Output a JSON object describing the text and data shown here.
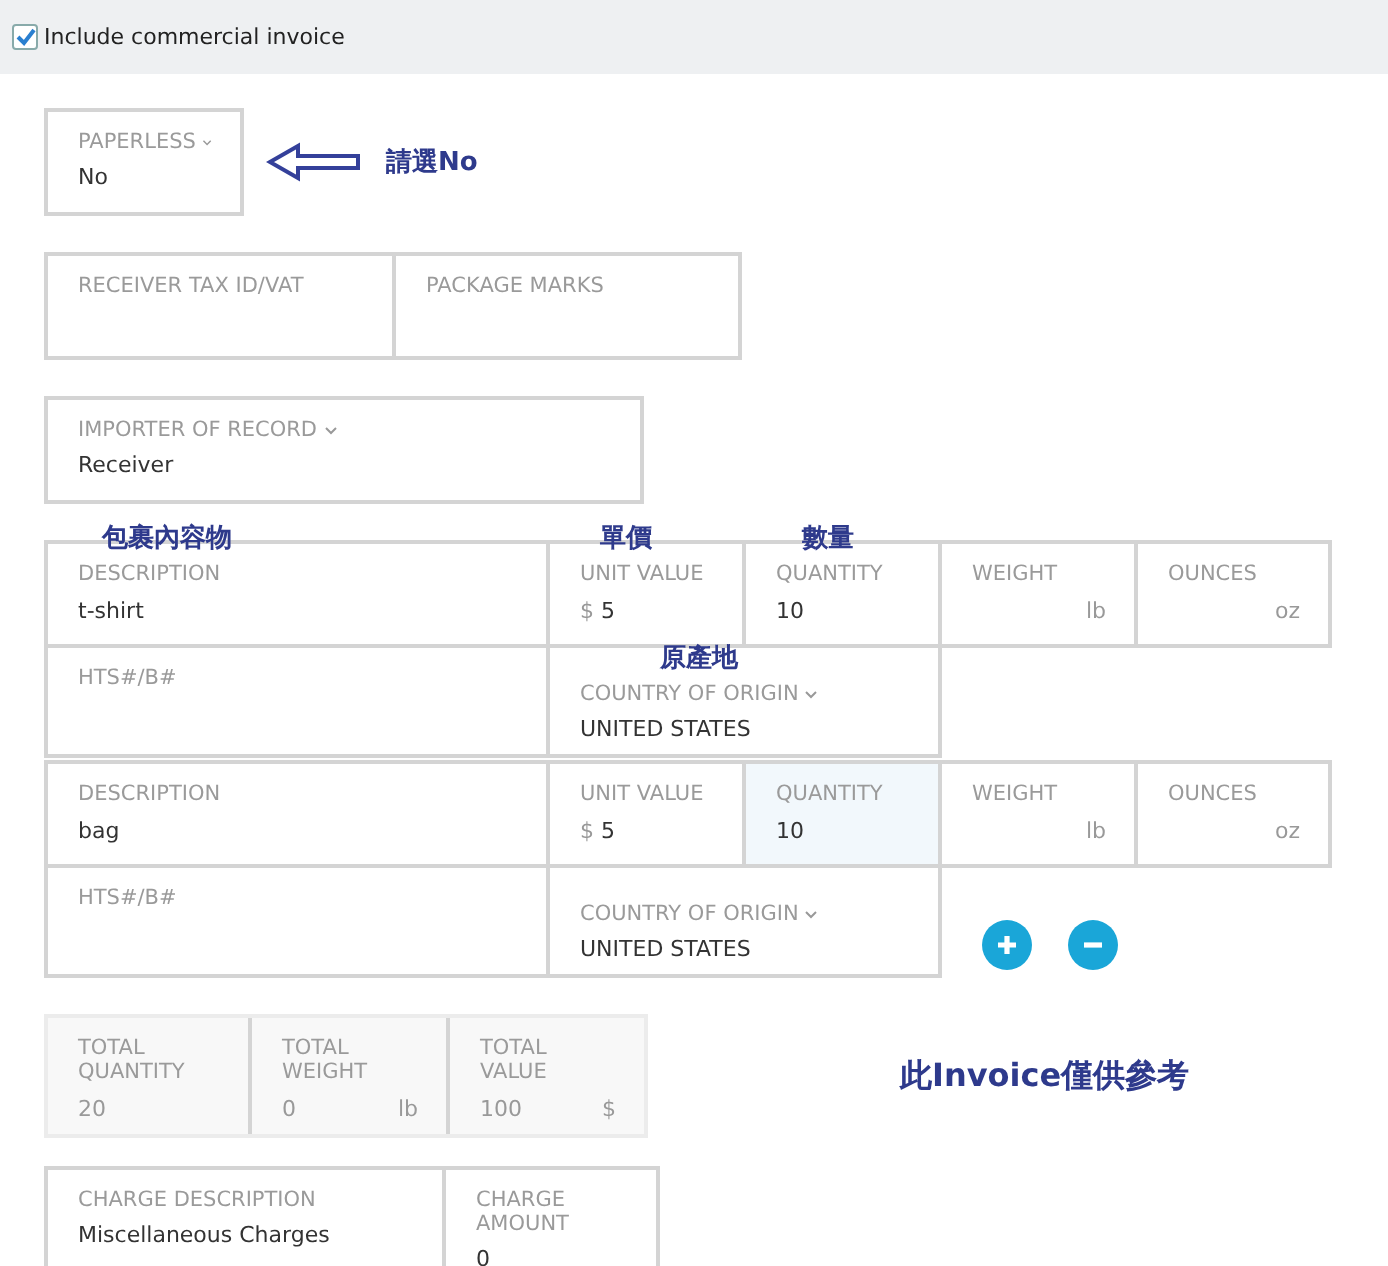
{
  "include_invoice": {
    "label": "Include commercial invoice",
    "checked": true
  },
  "paperless": {
    "label": "PAPERLESS",
    "value": "No",
    "dropdown": true,
    "note": "請選No"
  },
  "tax_fields": [
    {
      "label": "RECEIVER TAX ID/VAT"
    },
    {
      "label": "PACKAGE MARKS"
    }
  ],
  "importer": {
    "label": "IMPORTER OF RECORD",
    "value": "Receiver",
    "dropdown": true
  },
  "item_notes": [
    "包裹內容物",
    "單價",
    "數量",
    "原產地"
  ],
  "items": [
    {
      "fields": [
        {
          "label": "DESCRIPTION",
          "value": "t-shirt",
          "focused": false
        },
        {
          "label": "UNIT VALUE",
          "prefix": "$",
          "value": "5",
          "focused": false
        },
        {
          "label": "QUANTITY",
          "value": "10",
          "focused": false
        },
        {
          "label": "WEIGHT",
          "unit": "lb",
          "focused": false
        },
        {
          "label": "OUNCES",
          "unit": "oz",
          "focused": false
        }
      ],
      "hts": {
        "label": "HTS#/B#"
      },
      "origin": {
        "label": "COUNTRY OF ORIGIN",
        "value": "UNITED STATES",
        "dropdown": true
      }
    },
    {
      "fields": [
        {
          "label": "DESCRIPTION",
          "value": "bag",
          "focused": false
        },
        {
          "label": "UNIT VALUE",
          "prefix": "$",
          "value": "5",
          "focused": false
        },
        {
          "label": "QUANTITY",
          "value": "10",
          "focused": true
        },
        {
          "label": "WEIGHT",
          "unit": "lb",
          "focused": false
        },
        {
          "label": "OUNCES",
          "unit": "oz",
          "focused": false
        }
      ],
      "hts": {
        "label": "HTS#/B#"
      },
      "origin": {
        "label": "COUNTRY OF ORIGIN",
        "value": "UNITED STATES",
        "dropdown": true
      }
    }
  ],
  "totals": [
    {
      "label": "TOTAL QUANTITY",
      "value": "20"
    },
    {
      "label": "TOTAL WEIGHT",
      "value": "0",
      "unit": "lb"
    },
    {
      "label": "TOTAL VALUE",
      "value": "100",
      "unit": "$"
    }
  ],
  "note": "此Invoice僅供參考",
  "charges": [
    {
      "label": "CHARGE DESCRIPTION",
      "value": "Miscellaneous Charges"
    },
    {
      "label": "CHARGE AMOUNT",
      "value": "0"
    }
  ]
}
